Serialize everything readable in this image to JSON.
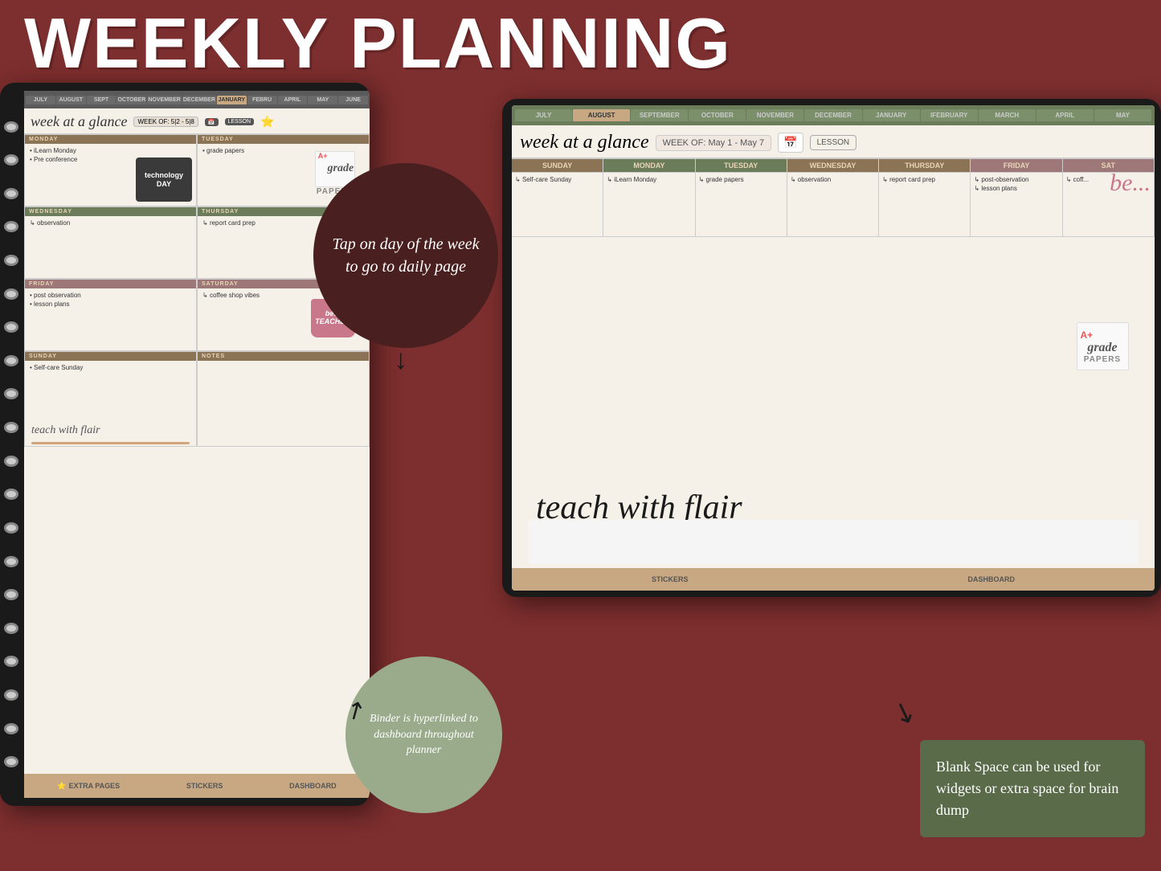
{
  "header": {
    "title": "WEEKLY PLANNING"
  },
  "leftTablet": {
    "months": [
      "JULY",
      "AUGUST",
      "SEPTEMBER",
      "OCTOBER",
      "NOVEMBER",
      "DECEMBER",
      "JANUARY",
      "FEBRU...",
      "APRIL",
      "MAY",
      "JUNE"
    ],
    "weekTitle": "week at a glance",
    "weekOf": "WEEK OF: 5|2 - 5|8",
    "days": {
      "monday": {
        "label": "MONDAY",
        "items": [
          "iLearn Monday",
          "Pre conference"
        ]
      },
      "tuesday": {
        "label": "TUESDAY",
        "items": [
          "grade papers"
        ]
      },
      "wednesday": {
        "label": "WEDNESDAY",
        "items": [
          "observation"
        ]
      },
      "thursday": {
        "label": "THURSDAY",
        "items": [
          "report card prep"
        ]
      },
      "friday": {
        "label": "FRIDAY",
        "items": [
          "post observation",
          "lesson plans"
        ]
      },
      "saturday": {
        "label": "SATURDAY",
        "items": [
          "coffee shop vibes"
        ]
      },
      "sunday": {
        "label": "SUNDAY",
        "items": [
          "Self-care Sunday"
        ]
      },
      "notes": {
        "label": "NOTES",
        "items": []
      }
    },
    "signature": "teach with flair",
    "bottomNav": [
      "EXTRA PAGES",
      "STICKERS",
      "DASHBOARD"
    ]
  },
  "rightTablet": {
    "months": [
      "JULY",
      "AUGUST",
      "SEPTEMBER",
      "OCTOBER",
      "NOVEMBER",
      "DECEMBER",
      "JANUARY",
      "FEBRUARY",
      "MARCH",
      "APRIL",
      "MAY"
    ],
    "weekTitle": "week at a glance",
    "weekOf": "WEEK OF: May 1 - May 7",
    "days": {
      "sunday": {
        "label": "SUNDAY",
        "items": [
          "Self-care Sunday"
        ]
      },
      "monday": {
        "label": "MONDAY",
        "items": [
          "iLearn Monday"
        ]
      },
      "tuesday": {
        "label": "TUESDAY",
        "items": [
          "grade papers"
        ]
      },
      "wednesday": {
        "label": "WEDNESDAY",
        "items": [
          "observation"
        ]
      },
      "thursday": {
        "label": "THURSDAY",
        "items": [
          "report card prep"
        ]
      },
      "friday": {
        "label": "FRIDAY",
        "items": [
          "post-observation",
          "lesson plans"
        ]
      },
      "saturday": {
        "label": "SAT",
        "items": [
          "coff..."
        ]
      }
    },
    "signature": "teach with flair",
    "bottomNav": [
      "STICKERS",
      "DASHBOARD"
    ]
  },
  "callouts": {
    "dark": "Tap on day of the week to go to daily page",
    "light": "Binder is hyperlinked to dashboard throughout planner",
    "blankSpace": "Blank Space can be used for widgets or extra space for brain dump"
  },
  "stickers": {
    "techDay": "technology DAY",
    "gradePapers": "grade PAPERS",
    "bestTeacher": "best TEACHER",
    "pencil": "✏️"
  }
}
